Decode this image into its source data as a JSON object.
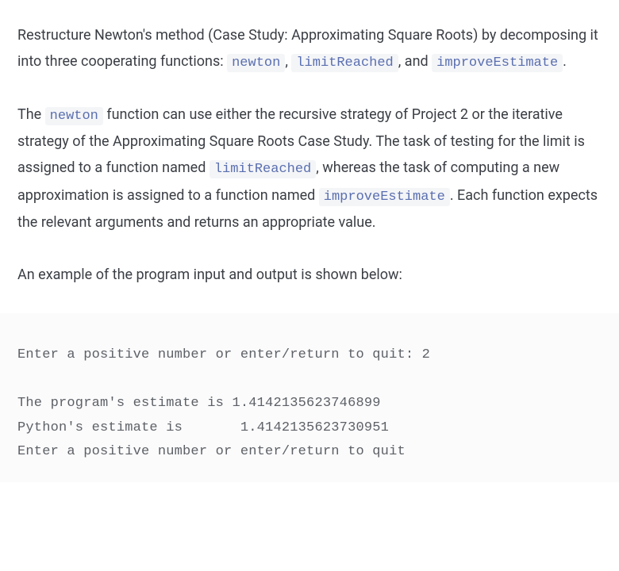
{
  "para1": {
    "t1": "Restructure Newton's method (Case Study: Approximating Square Roots) by decomposing it into three cooperating functions: ",
    "code1": "newton",
    "t2": ", ",
    "code2": "limitReached",
    "t3": ", and ",
    "code3": "improveEstimate",
    "t4": "."
  },
  "para2": {
    "t1": "The ",
    "code1": "newton",
    "t2": " function can use either the recursive strategy of Project 2 or the iterative strategy of the Approximating Square Roots Case Study. The task of testing for the limit is assigned to a function named ",
    "code2": "limitReached",
    "t3": ", whereas the task of computing a new approximation is assigned to a function named ",
    "code3": "improveEstimate",
    "t4": ". Each function expects the relevant arguments and returns an appropriate value."
  },
  "para3": {
    "t1": "An example of the program input and output is shown below:"
  },
  "output": "Enter a positive number or enter/return to quit: 2\n\nThe program's estimate is 1.4142135623746899\nPython's estimate is       1.4142135623730951\nEnter a positive number or enter/return to quit"
}
